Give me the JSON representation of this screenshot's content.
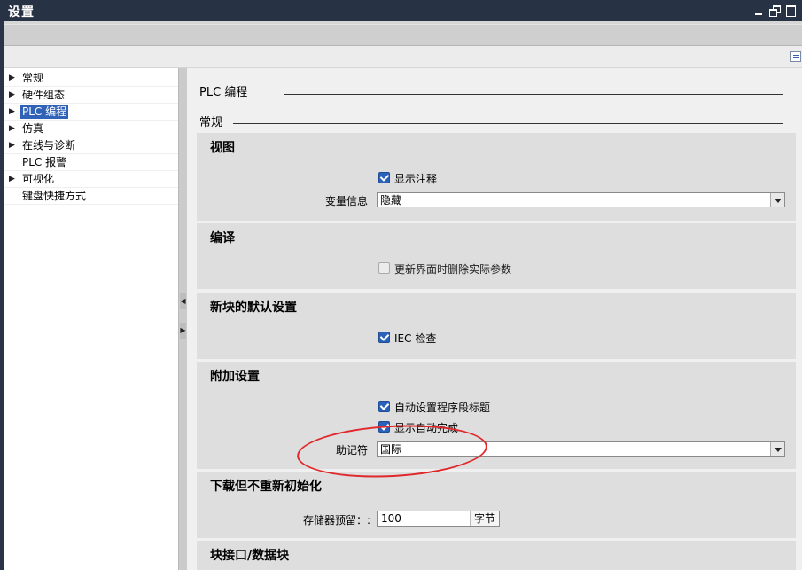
{
  "window": {
    "title": "设置"
  },
  "nav": {
    "items": [
      {
        "label": "常规",
        "expandable": true,
        "selected": false
      },
      {
        "label": "硬件组态",
        "expandable": true,
        "selected": false
      },
      {
        "label": "PLC 编程",
        "expandable": true,
        "selected": true
      },
      {
        "label": "仿真",
        "expandable": true,
        "selected": false
      },
      {
        "label": "在线与诊断",
        "expandable": true,
        "selected": false
      },
      {
        "label": "PLC 报警",
        "expandable": false,
        "selected": false
      },
      {
        "label": "可视化",
        "expandable": true,
        "selected": false
      },
      {
        "label": "键盘快捷方式",
        "expandable": false,
        "selected": false
      }
    ]
  },
  "page": {
    "heading": "PLC 编程",
    "subheading": "常规"
  },
  "sections": {
    "view": {
      "title": "视图",
      "show_comments": {
        "label": "显示注释",
        "checked": true
      },
      "var_info": {
        "label": "变量信息",
        "value": "隐藏"
      }
    },
    "compile": {
      "title": "编译",
      "delete_params": {
        "label": "更新界面时删除实际参数",
        "checked": false,
        "enabled": false
      }
    },
    "new_block": {
      "title": "新块的默认设置",
      "iec_check": {
        "label": "IEC 检查",
        "checked": true
      }
    },
    "additional": {
      "title": "附加设置",
      "auto_title": {
        "label": "自动设置程序段标题",
        "checked": true
      },
      "autocomplete": {
        "label": "显示自动完成",
        "checked": true
      },
      "mnemonic": {
        "label": "助记符",
        "value": "国际"
      }
    },
    "download": {
      "title": "下载但不重新初始化",
      "memory_reserve": {
        "label": "存储器预留：:",
        "value": "100",
        "unit": "字节"
      }
    },
    "block_interface": {
      "title": "块接口/数据块"
    }
  },
  "colors": {
    "titlebar": "#283245",
    "selection": "#3063b8",
    "annotation": "#e0282c"
  }
}
